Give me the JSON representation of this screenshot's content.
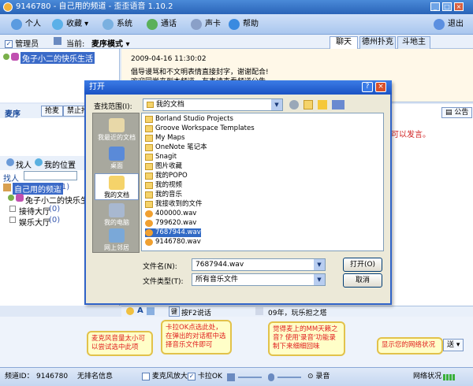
{
  "window": {
    "title": "9146780 - 自己用的频道 - 歪歪语音 1.10.2"
  },
  "toolbar": {
    "personal": "个人",
    "favorites": "收藏",
    "system": "系统",
    "phone": "通话",
    "sound_card": "声卡",
    "help": "帮助",
    "exit": "退出"
  },
  "subbar": {
    "admin_label": "管理员",
    "current_label": "当前:",
    "mode_label": "麦序模式"
  },
  "tabs": {
    "chat": "聊天",
    "texas": "德州扑克",
    "landlord": "斗地主"
  },
  "room_panel": {
    "user": "兔子小二的快乐生活"
  },
  "chat": {
    "timestamp": "2009-04-16 11:30:02",
    "msg1": "倡导谩骂和不文明表情直接封字，谢谢配合!",
    "msg2": "欢迎同学来到本频道，有事请查看频道公告",
    "announcement_button": "公告",
    "notice_right": "可以发言。"
  },
  "mic": {
    "title": "麦序",
    "grab_button": "抢麦",
    "ban_button": "禁止抢"
  },
  "find": {
    "find_label": "找人",
    "my_position_label": "我的位置",
    "find_person_label": "找人"
  },
  "tree": {
    "root": "自己用的频道",
    "root_count": "(1)",
    "user": "兔子小二的快乐生活",
    "room1": "接待大厅",
    "room1_count": "(0)",
    "room2": "娱乐大厅",
    "room2_count": "(0)"
  },
  "dialog": {
    "title": "打开",
    "lookin_label": "查找范围(I):",
    "lookin_value": "我的文档",
    "places": [
      "我最近的文档",
      "桌面",
      "我的文档",
      "我的电脑",
      "网上邻居"
    ],
    "files": [
      {
        "name": "Borland Studio Projects",
        "type": "folder"
      },
      {
        "name": "Groove Workspace Templates",
        "type": "folder"
      },
      {
        "name": "My Maps",
        "type": "folder"
      },
      {
        "name": "OneNote 笔记本",
        "type": "folder"
      },
      {
        "name": "Snagit",
        "type": "folder"
      },
      {
        "name": "图片收藏",
        "type": "folder"
      },
      {
        "name": "我的POPO",
        "type": "folder"
      },
      {
        "name": "我的视频",
        "type": "folder"
      },
      {
        "name": "我的音乐",
        "type": "folder"
      },
      {
        "name": "我接收到的文件",
        "type": "folder"
      },
      {
        "name": "400000.wav",
        "type": "wav"
      },
      {
        "name": "799620.wav",
        "type": "wav"
      },
      {
        "name": "7687944.wav",
        "type": "wav"
      },
      {
        "name": "9146780.wav",
        "type": "wav"
      }
    ],
    "filename_label": "文件名(N):",
    "filename_value": "7687944.wav",
    "filetype_label": "文件类型(T):",
    "filetype_value": "所有音乐文件",
    "open_button": "打开(O)",
    "cancel_button": "取消"
  },
  "input_tools": {
    "key_label": "键",
    "f2_label": "按F2说话",
    "song_label": "09年，玩乐担之塔"
  },
  "bubbles": {
    "mic_volume": "麦克风音量太小可以尝试选中此项",
    "karaoke": "卡拉OK点选此处，在弹出的对话框中选择音乐文件即可",
    "record": "觉得麦上的MM天籁之音? 使用'录音'功能录制下来细细回味",
    "network": "显示您的网络状况",
    "send_button": "送"
  },
  "statusbar": {
    "channel_id_label": "频道ID：",
    "channel_id": "9146780",
    "no_info": "无排名信息",
    "mic_amp": "麦克风放大",
    "karaoke": "卡拉OK",
    "record": "录音",
    "network": "网络状况"
  }
}
